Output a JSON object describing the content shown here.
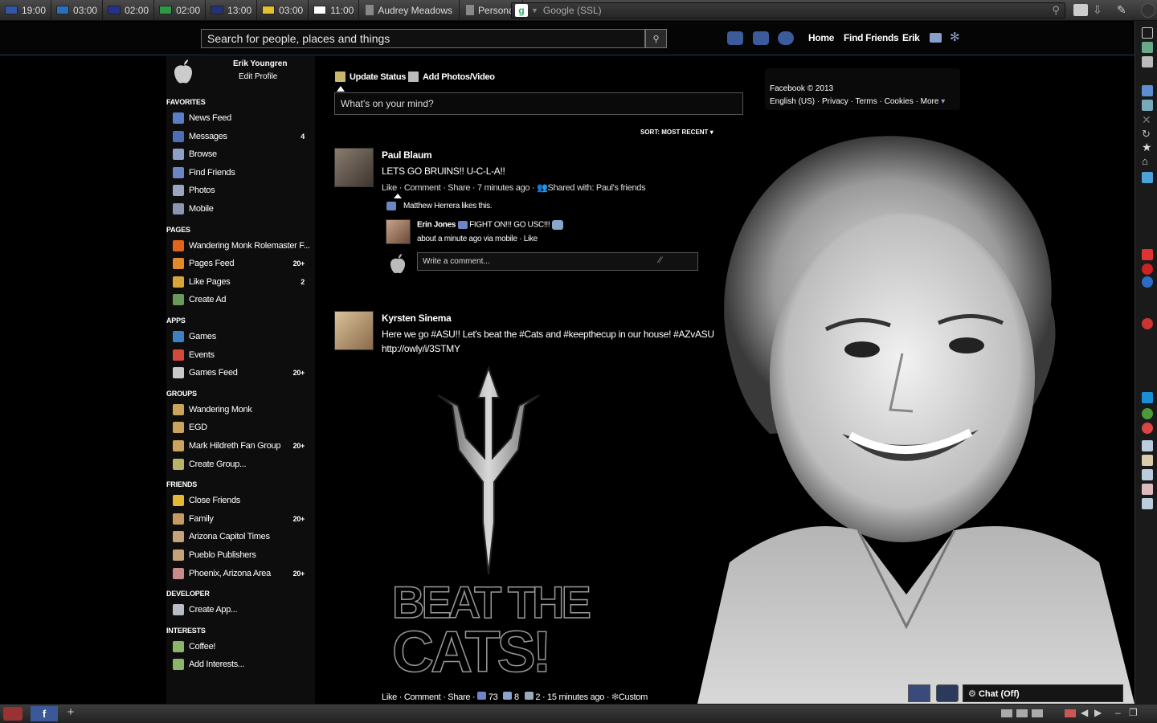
{
  "topbar": {
    "clocks": [
      {
        "flag": "us-flag-icon",
        "time": "19:00",
        "color": "#3355aa"
      },
      {
        "flag": "sweden-flag-icon",
        "time": "03:00",
        "color": "#2a6fbd"
      },
      {
        "flag": "uk-flag-icon",
        "time": "02:00",
        "color": "#24318f"
      },
      {
        "flag": "italy-flag-icon",
        "time": "02:00",
        "color": "#2e9a45"
      },
      {
        "flag": "australia-flag-icon",
        "time": "13:00",
        "color": "#23327a"
      },
      {
        "flag": "belgium-flag-icon",
        "time": "03:00",
        "color": "#e3c12a"
      },
      {
        "flag": "japan-flag-icon",
        "time": "11:00",
        "color": "#ffffff"
      }
    ],
    "tabs": [
      "Audrey Meadows",
      "Personal"
    ],
    "search_placeholder": "Google (SSL)"
  },
  "header": {
    "search_placeholder": "Search for people, places and things",
    "nav": {
      "home": "Home",
      "find_friends": "Find Friends",
      "user": "Erik"
    }
  },
  "profile": {
    "name": "Erik Youngren",
    "edit": "Edit Profile"
  },
  "leftnav": {
    "sections": [
      {
        "title": "FAVORITES",
        "items": [
          {
            "label": "News Feed",
            "count": "",
            "icon": "news-feed-icon",
            "color": "#5b7fc7"
          },
          {
            "label": "Messages",
            "count": "4",
            "icon": "messages-icon",
            "color": "#4d6db5"
          },
          {
            "label": "Browse",
            "count": "",
            "icon": "browse-icon",
            "color": "#8fa0c8"
          },
          {
            "label": "Find Friends",
            "count": "",
            "icon": "find-friends-icon",
            "color": "#6b86c2"
          },
          {
            "label": "Photos",
            "count": "",
            "icon": "photos-icon",
            "color": "#9aa6bf"
          },
          {
            "label": "Mobile",
            "count": "",
            "icon": "mobile-icon",
            "color": "#8a96b3"
          }
        ]
      },
      {
        "title": "PAGES",
        "items": [
          {
            "label": "Wandering Monk Rolemaster F...",
            "count": "",
            "icon": "fire-icon",
            "color": "#e0641c"
          },
          {
            "label": "Pages Feed",
            "count": "20+",
            "icon": "pages-feed-icon",
            "color": "#e08a2c"
          },
          {
            "label": "Like Pages",
            "count": "2",
            "icon": "like-pages-icon",
            "color": "#d9a53a"
          },
          {
            "label": "Create Ad",
            "count": "",
            "icon": "create-ad-icon",
            "color": "#6a9a5a"
          }
        ]
      },
      {
        "title": "APPS",
        "items": [
          {
            "label": "Games",
            "count": "",
            "icon": "games-icon",
            "color": "#3e7fc2"
          },
          {
            "label": "Events",
            "count": "",
            "icon": "events-icon",
            "color": "#d44a3a"
          },
          {
            "label": "Games Feed",
            "count": "20+",
            "icon": "games-feed-icon",
            "color": "#c9c9c9"
          }
        ]
      },
      {
        "title": "GROUPS",
        "items": [
          {
            "label": "Wandering Monk",
            "count": "",
            "icon": "group-icon",
            "color": "#c9a45a"
          },
          {
            "label": "EGD",
            "count": "",
            "icon": "group-icon",
            "color": "#c9a45a"
          },
          {
            "label": "Mark Hildreth Fan Group",
            "count": "20+",
            "icon": "group-icon",
            "color": "#c9a45a"
          },
          {
            "label": "Create Group...",
            "count": "",
            "icon": "create-group-icon",
            "color": "#b8b26a"
          }
        ]
      },
      {
        "title": "FRIENDS",
        "items": [
          {
            "label": "Close Friends",
            "count": "",
            "icon": "close-friends-icon",
            "color": "#e3b834"
          },
          {
            "label": "Family",
            "count": "20+",
            "icon": "family-icon",
            "color": "#c79a62"
          },
          {
            "label": "Arizona Capitol Times",
            "count": "",
            "icon": "friend-list-icon",
            "color": "#c5a27a"
          },
          {
            "label": "Pueblo Publishers",
            "count": "",
            "icon": "friend-list-icon",
            "color": "#c5a27a"
          },
          {
            "label": "Phoenix, Arizona Area",
            "count": "20+",
            "icon": "location-list-icon",
            "color": "#c98a8a"
          }
        ]
      },
      {
        "title": "DEVELOPER",
        "items": [
          {
            "label": "Create App...",
            "count": "",
            "icon": "gear-app-icon",
            "color": "#b8bcc6"
          }
        ]
      },
      {
        "title": "INTERESTS",
        "items": [
          {
            "label": "Coffee!",
            "count": "",
            "icon": "interest-list-icon",
            "color": "#8db56a"
          },
          {
            "label": "Add Interests...",
            "count": "",
            "icon": "add-interests-icon",
            "color": "#8db56a"
          }
        ]
      }
    ]
  },
  "composer": {
    "update_status": "Update Status",
    "add_photos": "Add Photos/Video",
    "placeholder": "What's on your mind?"
  },
  "sort_label": "SORT: MOST RECENT",
  "stories": [
    {
      "author": "Paul Blaum",
      "text": "LETS GO BRUINS!! U-C-L-A!!",
      "actions": "Like · Comment · Share · 7 minutes ago · ",
      "shared": "Shared with: Paul's friends",
      "likes": "Matthew Herrera likes this.",
      "comment": {
        "author": "Erin Jones",
        "text": "FIGHT ON!!! GO USC!!!",
        "meta": "about a minute ago via mobile · Like"
      },
      "write_comment": "Write a comment..."
    },
    {
      "author": "Kyrsten Sinema",
      "text_line1": "Here we go #ASU!! Let's beat the #Cats and #keepthecup in our house! #AZvASU",
      "text_line2": "http://owly/i/3STMY",
      "image_text_line1": "BEAT THE",
      "image_text_line2": "CATS!",
      "actions": "Like · Comment · Share · ",
      "likes_count": "73",
      "shares_count": "8",
      "comments_count": "2",
      "time": "· 15 minutes ago · ",
      "privacy": "Custom"
    }
  ],
  "rightcol": {
    "copyright": "Facebook © 2013",
    "links": "English (US) · Privacy · Terms · Cookies · More"
  },
  "chat": {
    "label": "Chat (Off)"
  }
}
